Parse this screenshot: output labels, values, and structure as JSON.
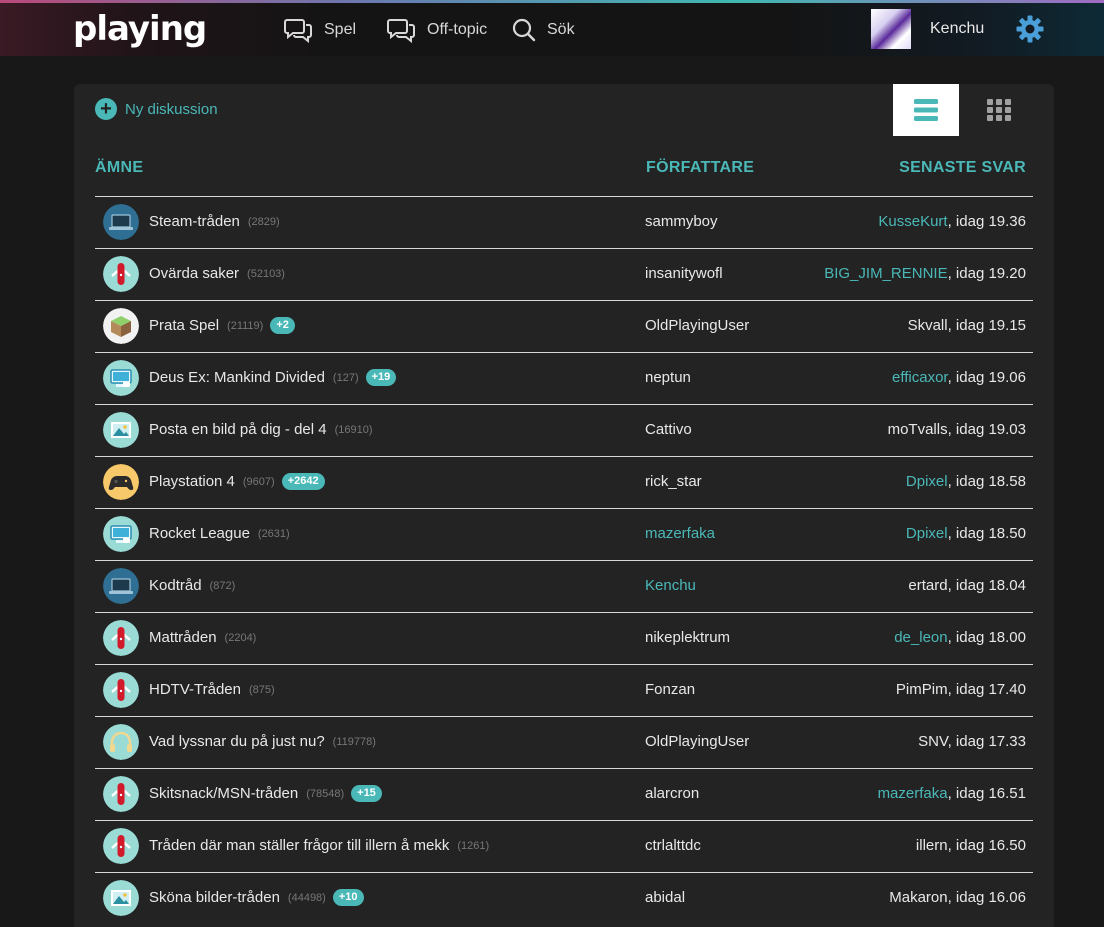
{
  "header": {
    "logo": "playing",
    "nav": [
      {
        "label": "Spel"
      },
      {
        "label": "Off-topic"
      },
      {
        "label": "Sök"
      }
    ],
    "username": "Kenchu"
  },
  "toolbar": {
    "new_discussion": "Ny diskussion"
  },
  "table": {
    "columns": [
      "ÄMNE",
      "FÖRFATTARE",
      "SENASTE SVAR"
    ],
    "rows": [
      {
        "icon": "laptop-icon",
        "title": "Steam-tråden",
        "count": "(2829)",
        "badge": "",
        "author": "sammyboy",
        "author_link": false,
        "last_user": "KusseKurt",
        "last_user_link": true,
        "last_time": ", idag 19.36"
      },
      {
        "icon": "knife-icon",
        "title": "Ovärda saker",
        "count": "(52103)",
        "badge": "",
        "author": "insanitywofl",
        "author_link": false,
        "last_user": "BIG_JIM_RENNIE",
        "last_user_link": true,
        "last_time": ", idag 19.20"
      },
      {
        "icon": "cube-icon",
        "title": "Prata Spel",
        "count": "(21119)",
        "badge": "+2",
        "author": "OldPlayingUser",
        "author_link": false,
        "last_user": "Skvall",
        "last_user_link": false,
        "last_time": ", idag 19.15"
      },
      {
        "icon": "computer-icon",
        "title": "Deus Ex: Mankind Divided",
        "count": "(127)",
        "badge": "+19",
        "author": "neptun",
        "author_link": false,
        "last_user": "efficaxor",
        "last_user_link": true,
        "last_time": ", idag 19.06"
      },
      {
        "icon": "image-icon",
        "title": "Posta en bild på dig - del 4",
        "count": "(16910)",
        "badge": "",
        "author": "Cattivo",
        "author_link": false,
        "last_user": "moTvalls",
        "last_user_link": false,
        "last_time": ", idag 19.03"
      },
      {
        "icon": "gamepad-icon",
        "title": "Playstation 4",
        "count": "(9607)",
        "badge": "+2642",
        "author": "rick_star",
        "author_link": false,
        "last_user": "Dpixel",
        "last_user_link": true,
        "last_time": ", idag 18.58"
      },
      {
        "icon": "computer-icon",
        "title": "Rocket League",
        "count": "(2631)",
        "badge": "",
        "author": "mazerfaka",
        "author_link": true,
        "last_user": "Dpixel",
        "last_user_link": true,
        "last_time": ", idag 18.50"
      },
      {
        "icon": "laptop-icon",
        "title": "Kodtråd",
        "count": "(872)",
        "badge": "",
        "author": "Kenchu",
        "author_link": true,
        "last_user": "ertard",
        "last_user_link": false,
        "last_time": ", idag 18.04"
      },
      {
        "icon": "knife-icon",
        "title": "Mattråden",
        "count": "(2204)",
        "badge": "",
        "author": "nikeplektrum",
        "author_link": false,
        "last_user": "de_leon",
        "last_user_link": true,
        "last_time": ", idag 18.00"
      },
      {
        "icon": "knife-icon",
        "title": "HDTV-Tråden",
        "count": "(875)",
        "badge": "",
        "author": "Fonzan",
        "author_link": false,
        "last_user": "PimPim",
        "last_user_link": false,
        "last_time": ", idag 17.40"
      },
      {
        "icon": "headphones-icon",
        "title": "Vad lyssnar du på just nu?",
        "count": "(119778)",
        "badge": "",
        "author": "OldPlayingUser",
        "author_link": false,
        "last_user": "SNV",
        "last_user_link": false,
        "last_time": ", idag 17.33"
      },
      {
        "icon": "knife-icon",
        "title": "Skitsnack/MSN-tråden",
        "count": "(78548)",
        "badge": "+15",
        "author": "alarcron",
        "author_link": false,
        "last_user": "mazerfaka",
        "last_user_link": true,
        "last_time": ", idag 16.51"
      },
      {
        "icon": "knife-icon",
        "title": "Tråden där man ställer frågor till illern å mekk",
        "count": "(1261)",
        "badge": "",
        "author": "ctrlalttdc",
        "author_link": false,
        "last_user": "illern",
        "last_user_link": false,
        "last_time": ", idag 16.50"
      },
      {
        "icon": "image-icon",
        "title": "Sköna bilder-tråden",
        "count": "(44498)",
        "badge": "+10",
        "author": "abidal",
        "author_link": false,
        "last_user": "Makaron",
        "last_user_link": false,
        "last_time": ", idag 16.06"
      }
    ]
  },
  "colors": {
    "accent": "#4bb8b8",
    "background": "#181818",
    "panel": "#232323"
  }
}
